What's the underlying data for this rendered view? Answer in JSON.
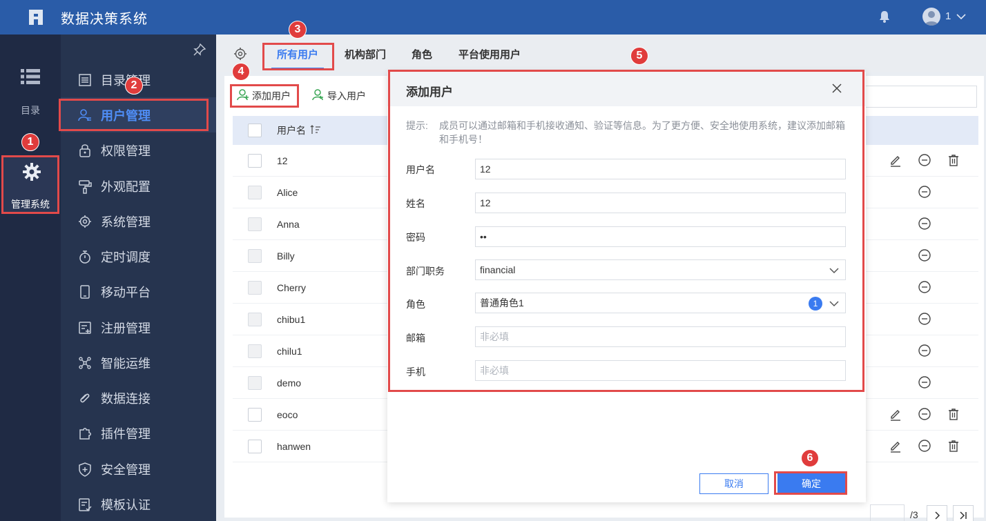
{
  "app": {
    "title": "数据决策系统",
    "user": "1"
  },
  "iconbar": {
    "catalog_label": "目录",
    "system_label": "管理系统"
  },
  "menu": {
    "items": [
      {
        "label": "目录管理",
        "icon": "list-icon"
      },
      {
        "label": "用户管理",
        "icon": "user-manage-icon"
      },
      {
        "label": "权限管理",
        "icon": "lock-icon"
      },
      {
        "label": "外观配置",
        "icon": "paint-roller-icon"
      },
      {
        "label": "系统管理",
        "icon": "gear-icon"
      },
      {
        "label": "定时调度",
        "icon": "stopwatch-icon"
      },
      {
        "label": "移动平台",
        "icon": "mobile-icon"
      },
      {
        "label": "注册管理",
        "icon": "register-icon"
      },
      {
        "label": "智能运维",
        "icon": "network-icon"
      },
      {
        "label": "数据连接",
        "icon": "link-icon"
      },
      {
        "label": "插件管理",
        "icon": "puzzle-icon"
      },
      {
        "label": "安全管理",
        "icon": "shield-icon"
      },
      {
        "label": "模板认证",
        "icon": "template-cert-icon"
      }
    ]
  },
  "tabs": [
    "所有用户",
    "机构部门",
    "角色",
    "平台使用用户"
  ],
  "toolbar": {
    "add_user": "添加用户",
    "import_user": "导入用户"
  },
  "table": {
    "header_name": "用户名",
    "rows": [
      "12",
      "Alice",
      "Anna",
      "Billy",
      "Cherry",
      "chibu1",
      "chilu1",
      "demo",
      "eoco",
      "hanwen"
    ],
    "truncated_cell": "用"
  },
  "pager": {
    "total": "/3"
  },
  "modal": {
    "title": "添加用户",
    "hint_label": "提示:",
    "hint_text": "成员可以通过邮箱和手机接收通知、验证等信息。为了更方便、安全地使用系统，建议添加邮箱和手机号！",
    "fields": {
      "username": {
        "label": "用户名",
        "value": "12"
      },
      "realname": {
        "label": "姓名",
        "value": "12"
      },
      "password": {
        "label": "密码",
        "value": "••"
      },
      "department": {
        "label": "部门职务",
        "value": "financial"
      },
      "role": {
        "label": "角色",
        "value": "普通角色1",
        "count": "1"
      },
      "email": {
        "label": "邮箱",
        "placeholder": "非必填"
      },
      "phone": {
        "label": "手机",
        "placeholder": "非必填"
      }
    },
    "cancel": "取消",
    "ok": "确定"
  },
  "steps": [
    "1",
    "2",
    "3",
    "4",
    "5",
    "6"
  ],
  "colors": {
    "brand": "#2a5ca8",
    "accent": "#3a7bf0",
    "highlight": "#e24a4a"
  }
}
